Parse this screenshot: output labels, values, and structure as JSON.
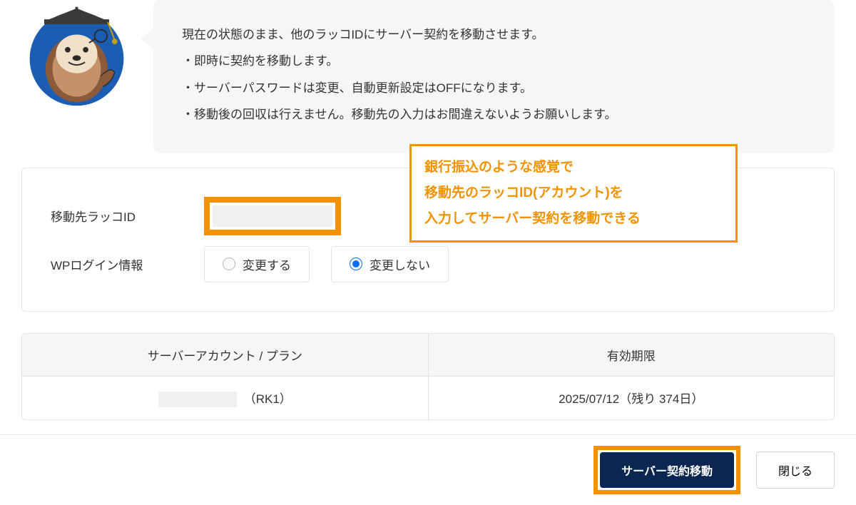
{
  "speech": {
    "line1": "現在の状態のまま、他のラッコIDにサーバー契約を移動させます。",
    "bullet1": "・即時に契約を移動します。",
    "bullet2": "・サーバーパスワードは変更、自動更新設定はOFFになります。",
    "bullet3": "・移動後の回収は行えません。移動先の入力はお間違えないようお願いします。"
  },
  "form": {
    "rakko_id_label": "移動先ラッコID",
    "rakko_id_value": "",
    "wp_login_label": "WPログイン情報",
    "radio_change": "変更する",
    "radio_nochange": "変更しない"
  },
  "annotation": {
    "line1": "銀行振込のような感覚で",
    "line2": "移動先のラッコID(アカウント)を",
    "line3": "入力してサーバー契約を移動できる"
  },
  "table": {
    "col1": "サーバーアカウント / プラン",
    "col2": "有効期限",
    "row_plan": "（RK1）",
    "row_expire": "2025/07/12（残り 374日）"
  },
  "footer": {
    "primary": "サーバー契約移動",
    "secondary": "閉じる"
  }
}
